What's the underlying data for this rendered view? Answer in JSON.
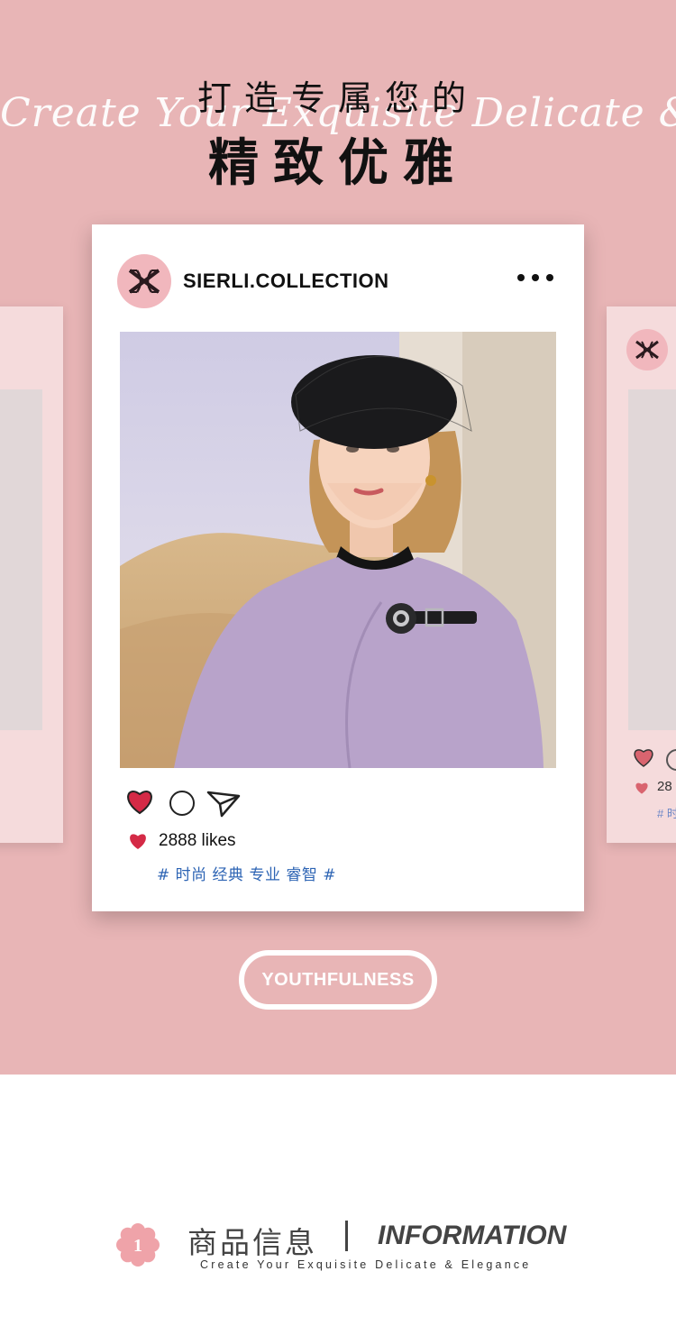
{
  "header": {
    "script_line": "Create Your Exquisite Delicate & Elegance",
    "title_line1": "打造专属您的",
    "title_line2": "精致优雅"
  },
  "post": {
    "account_name": "SIERLI.COLLECTION",
    "more_icon": "more-horizontal-icon",
    "likes_text": "2888 likes",
    "hashtags": "# 时尚 经典 专业 睿智 #",
    "actions": [
      "heart-icon",
      "comment-icon",
      "send-icon"
    ]
  },
  "side_card_right": {
    "likes_text": "28",
    "hashtags": "# 时"
  },
  "badge": {
    "label": "YOUTHFULNESS"
  },
  "info_section": {
    "number": "1",
    "title_cn": "商品信息",
    "title_en": "INFORMATION",
    "subtitle": "Create Your Exquisite Delicate & Elegance"
  },
  "colors": {
    "background_pink": "#e8b5b6",
    "heart_red": "#d42a46",
    "hashtag_blue": "#2d64b4",
    "logo_pink": "#f1b7bd",
    "side_card_pink": "#f5dbdc"
  }
}
